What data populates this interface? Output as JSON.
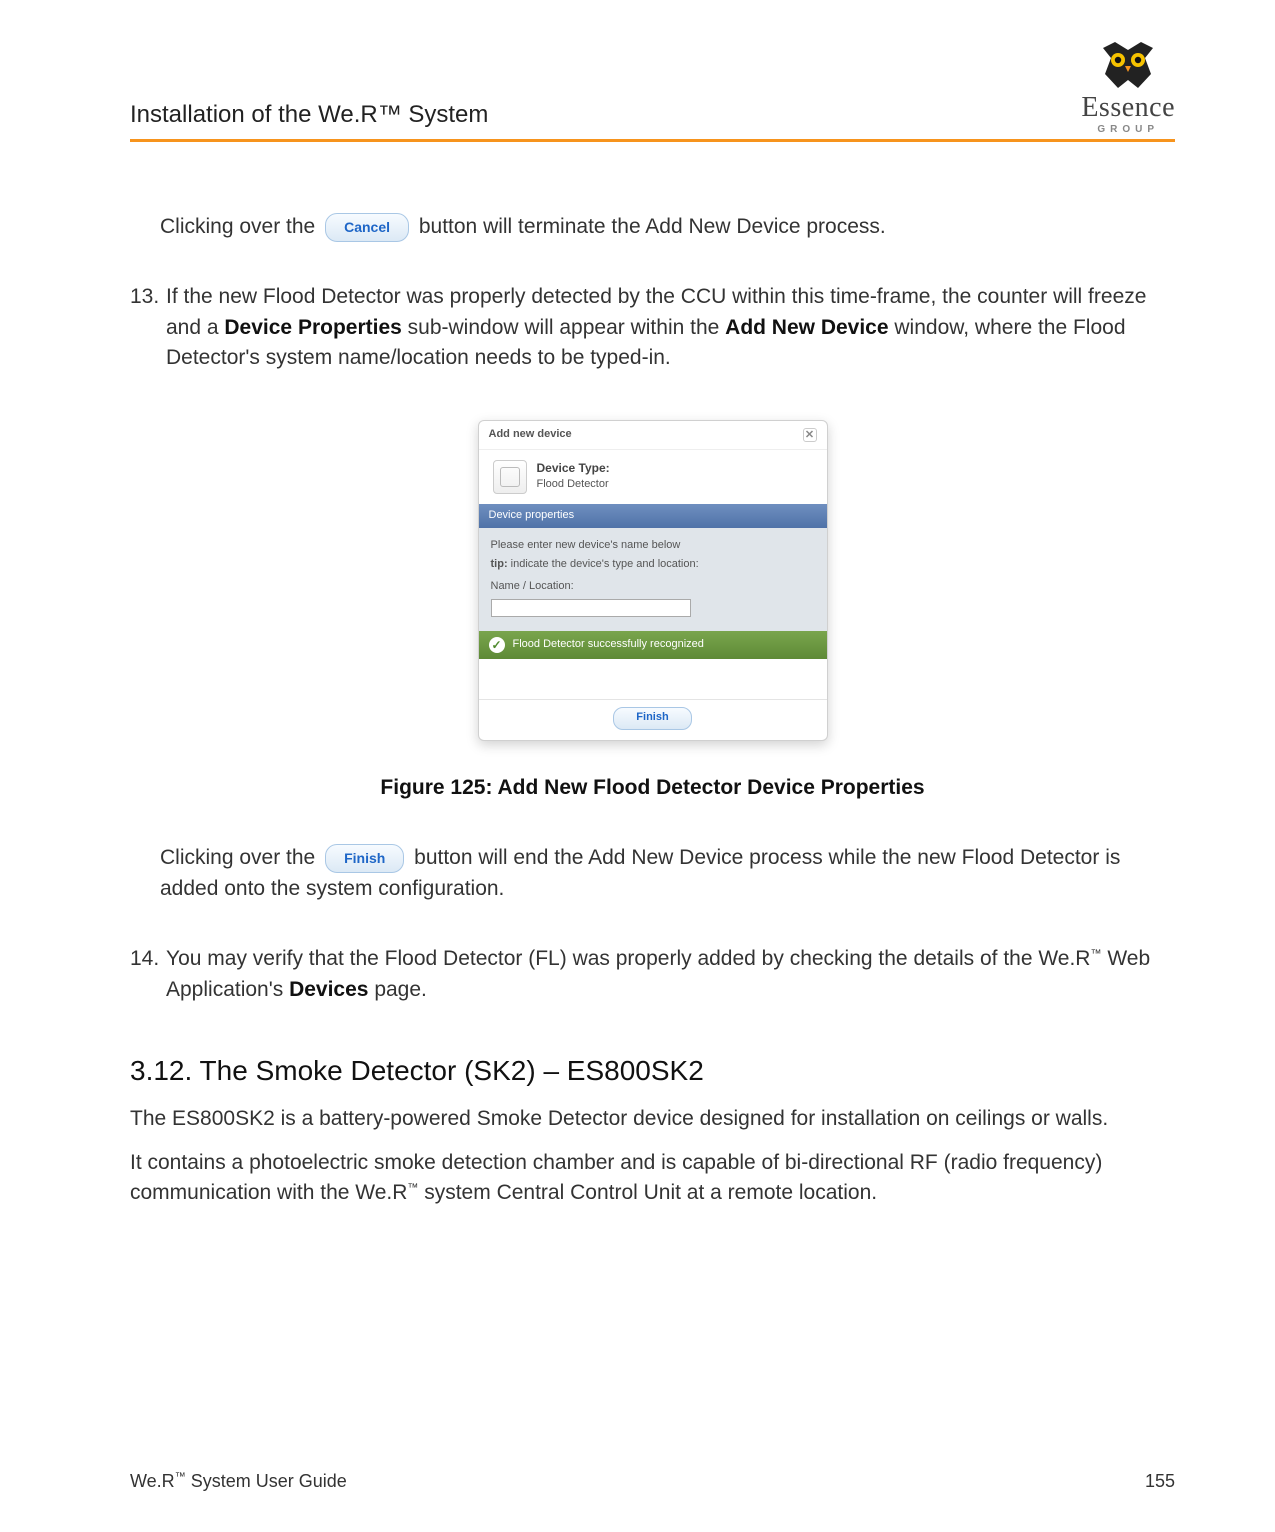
{
  "header": {
    "title": "Installation of the We.R™ System",
    "brand": "Essence",
    "brand_sub": "GROUP"
  },
  "para_cancel": {
    "pre": "Clicking over the ",
    "btn": "Cancel",
    "post": " button will terminate the Add New Device process."
  },
  "item13": {
    "num": "13.",
    "t1": "If the new Flood Detector was properly detected by the CCU within this time-frame, the counter will freeze and a ",
    "b1": "Device Properties",
    "t2": " sub-window will appear within the ",
    "b2": "Add New Device",
    "t3": " window, where the Flood Detector's system name/location needs to be typed-in."
  },
  "dialog": {
    "title": "Add new device",
    "dev_label": "Device Type:",
    "dev_value": "Flood Detector",
    "props_header": "Device properties",
    "line1": "Please enter new device's name below",
    "line2a": "tip:",
    "line2b": " indicate the device's type and location:",
    "label": "Name / Location:",
    "recognized": "Flood Detector successfully recognized",
    "finish": "Finish"
  },
  "figure_caption": "Figure 125: Add New Flood Detector Device Properties",
  "para_finish": {
    "pre": "Clicking over the ",
    "btn": "Finish",
    "post": " button will end the Add New Device process while the new Flood Detector is added onto the system configuration."
  },
  "item14": {
    "num": "14.",
    "t1": "You may verify that the Flood Detector (FL) was properly added by checking the details of the We.R",
    "sup": "™",
    "t2": " Web Application's ",
    "b1": "Devices",
    "t3": " page."
  },
  "section": {
    "heading": "3.12.  The Smoke Detector (SK2) – ES800SK2",
    "p1": "The ES800SK2 is a battery-powered Smoke Detector device designed for installation on ceilings or walls.",
    "p2a": "It contains a photoelectric smoke detection chamber and is capable of bi-directional RF (radio frequency) communication with the We.R",
    "p2sup": "™",
    "p2b": " system Central Control Unit at a remote location."
  },
  "footer": {
    "left_a": "We.R",
    "left_sup": "™",
    "left_b": " System User Guide",
    "page": "155"
  }
}
